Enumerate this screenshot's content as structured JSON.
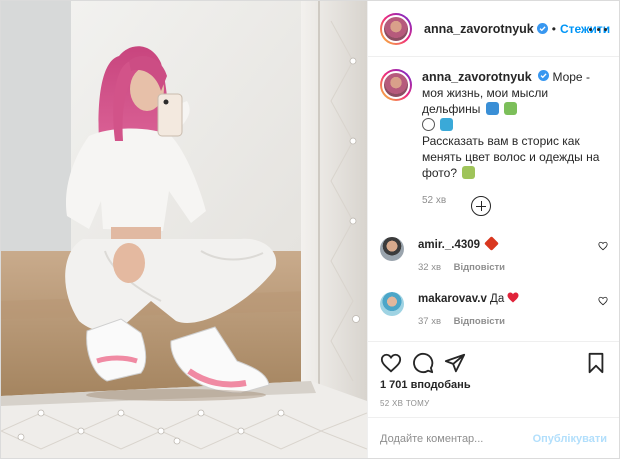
{
  "post": {
    "author": "anna_zavorotnyuk",
    "follow_label": "Стежити",
    "separator": "•",
    "caption_line1": "Море - моя жизнь, мои мысли дельфины",
    "caption_line2": "Рассказать вам в сторис как менять цвет волос и одежды на фото?",
    "caption_time": "52 хв",
    "colors": {
      "accent": "#0095f6",
      "muted": "#8e8e8e",
      "text": "#262626",
      "heart": "#ed4956"
    }
  },
  "comments": [
    {
      "user": "amir._.4309",
      "text": "",
      "time": "32 хв",
      "reply_label": "Відповісти"
    },
    {
      "user": "makarovav.v",
      "text": "Да",
      "time": "37 хв",
      "reply_label": "Відповісти"
    }
  ],
  "actions": {
    "icons": [
      "heart-icon",
      "comment-icon",
      "share-icon",
      "bookmark-icon"
    ]
  },
  "likes_text": "1 701 вподобань",
  "posted_ago": "52 ХВ ТОМУ",
  "comment_box": {
    "placeholder": "Додайте коментар...",
    "post_label": "Опублікувати"
  }
}
